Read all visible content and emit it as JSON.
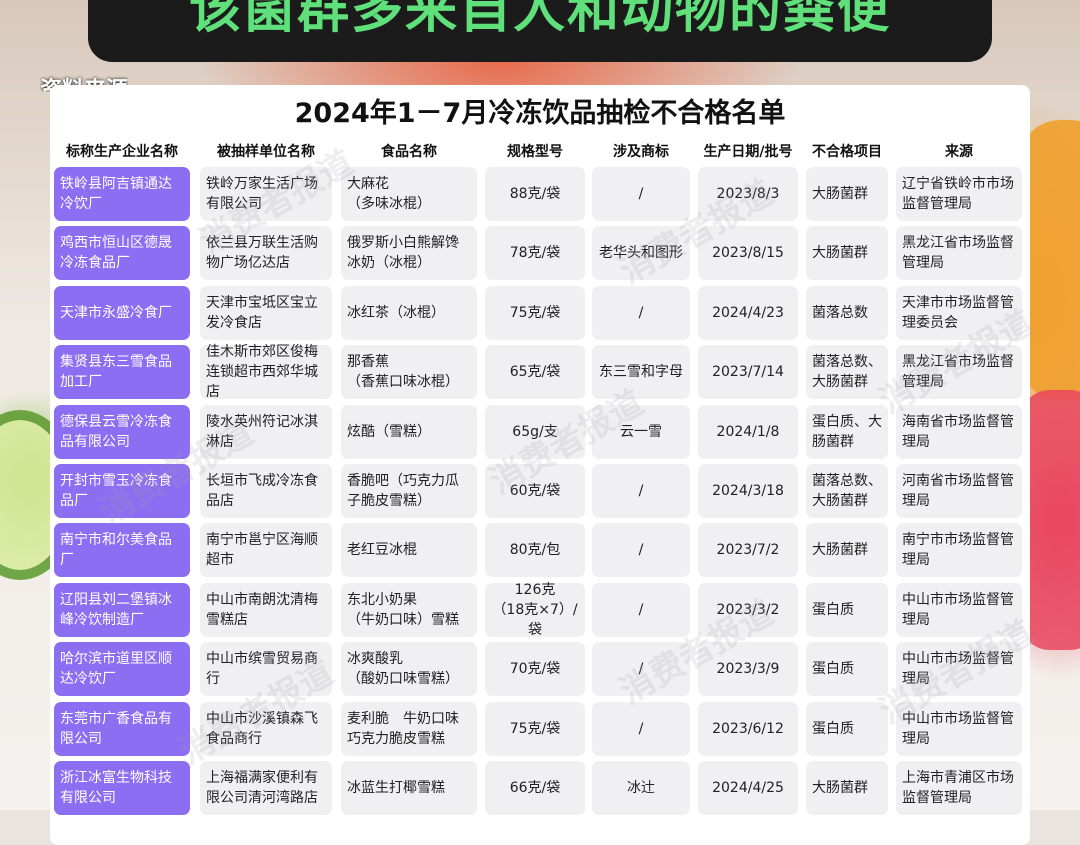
{
  "banner": {
    "text": "该菌群多来自人和动物的粪便"
  },
  "source_label": "资料来源",
  "card": {
    "title": "2024年1－7月冷冻饮品抽检不合格名单",
    "watermark": "消费者报道",
    "headers": [
      "标称生产企业名称",
      "被抽样单位名称",
      "食品名称",
      "规格型号",
      "涉及商标",
      "生产日期/批号",
      "不合格项目",
      "来源"
    ],
    "rows": [
      [
        "铁岭县阿吉镇通达冷饮厂",
        "铁岭万家生活广场有限公司",
        "大麻花\n（多味冰棍）",
        "88克/袋",
        "/",
        "2023/8/3",
        "大肠菌群",
        "辽宁省铁岭市市场监督管理局"
      ],
      [
        "鸡西市恒山区德晟冷冻食品厂",
        "依兰县万联生活购物广场亿达店",
        "俄罗斯小白熊解馋冰奶（冰棍）",
        "78克/袋",
        "老华头和图形",
        "2023/8/15",
        "大肠菌群",
        "黑龙江省市场监督管理局"
      ],
      [
        "天津市永盛冷食厂",
        "天津市宝坻区宝立发冷食店",
        "冰红茶（冰棍）",
        "75克/袋",
        "/",
        "2024/4/23",
        "菌落总数",
        "天津市市场监督管理委员会"
      ],
      [
        "集贤县东三雪食品加工厂",
        "佳木斯市郊区俊梅连锁超市西郊华城店",
        "那香蕉\n（香蕉口味冰棍）",
        "65克/袋",
        "东三雪和字母",
        "2023/7/14",
        "菌落总数、大肠菌群",
        "黑龙江省市场监督管理局"
      ],
      [
        "德保县云雪冷冻食品有限公司",
        "陵水英州符记冰淇淋店",
        "炫酷（雪糕）",
        "65g/支",
        "云一雪",
        "2024/1/8",
        "蛋白质、大肠菌群",
        "海南省市场监督管理局"
      ],
      [
        "开封市雪玉冷冻食品厂",
        "长垣市飞成冷冻食品店",
        "香脆吧（巧克力瓜子脆皮雪糕）",
        "60克/袋",
        "/",
        "2024/3/18",
        "菌落总数、大肠菌群",
        "河南省市场监督管理局"
      ],
      [
        "南宁市和尔美食品厂",
        "南宁市邕宁区海顺超市",
        "老红豆冰棍",
        "80克/包",
        "/",
        "2023/7/2",
        "大肠菌群",
        "南宁市市场监督管理局"
      ],
      [
        "辽阳县刘二堡镇冰峰冷饮制造厂",
        "中山市南朗沈清梅雪糕店",
        "东北小奶果\n（牛奶口味）雪糕",
        "126克\n（18克×7）/袋",
        "/",
        "2023/3/2",
        "蛋白质",
        "中山市市场监督管理局"
      ],
      [
        "哈尔滨市道里区顺达冷饮厂",
        "中山市缤雪贸易商行",
        "冰爽酸乳\n（酸奶口味雪糕）",
        "70克/袋",
        "/",
        "2023/3/9",
        "蛋白质",
        "中山市市场监督管理局"
      ],
      [
        "东莞市广香食品有限公司",
        "中山市沙溪镇森飞食品商行",
        "麦利脆　牛奶口味巧克力脆皮雪糕",
        "75克/袋",
        "/",
        "2023/6/12",
        "蛋白质",
        "中山市市场监督管理局"
      ],
      [
        "浙江冰富生物科技有限公司",
        "上海福满家便利有限公司清河湾路店",
        "冰蓝生打椰雪糕",
        "66克/袋",
        "冰辻",
        "2024/4/25",
        "大肠菌群",
        "上海市青浦区市场监督管理局"
      ]
    ]
  },
  "colors": {
    "accent_purple": "#8c6ef2",
    "banner_green": "#5fe07a",
    "banner_bg": "#1b1b1b"
  }
}
